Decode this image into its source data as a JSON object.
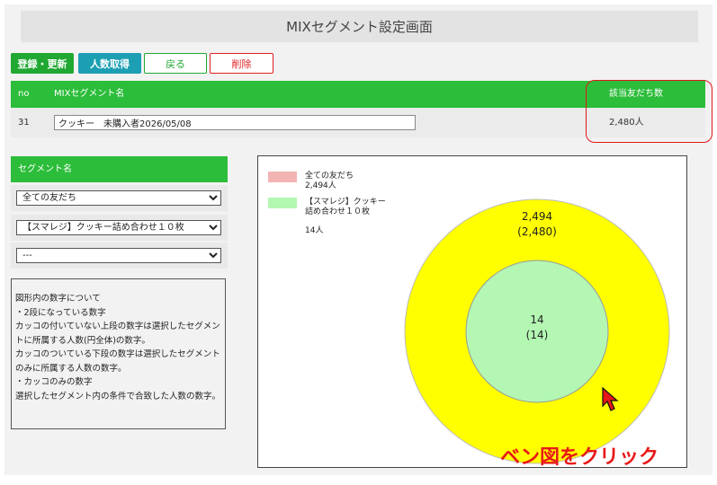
{
  "page": {
    "title": "MIXセグメント設定画面"
  },
  "toolbar": {
    "register_label": "登録・更新",
    "get_count_label": "人数取得",
    "back_label": "戻る",
    "delete_label": "削除"
  },
  "table": {
    "headers": {
      "no": "no",
      "name": "MIXセグメント名",
      "count": "該当友だち数"
    },
    "row": {
      "no": "31",
      "name": "クッキー　未購入者2026/05/08",
      "count": "2,480人"
    }
  },
  "segments": {
    "header": "セグメント名",
    "selects": [
      {
        "selected": "全ての友だち"
      },
      {
        "selected": "【スマレジ】クッキー詰め合わせ１０枚"
      },
      {
        "selected": "---"
      }
    ]
  },
  "info": {
    "lines": [
      "図形内の数字について",
      "・2段になっている数字",
      "カッコの付いていない上段の数字は選択したセグメントに所属する人数(円全体)の数字。",
      "カッコのついている下段の数字は選択したセグメントのみに所属する人数の数字。",
      "・カッコのみの数字",
      "選択したセグメント内の条件で合致した人数の数字。"
    ]
  },
  "venn": {
    "legend": [
      {
        "label": "全ての友だち",
        "count": "2,494人",
        "color": "#f4b3b3"
      },
      {
        "label": "【スマレジ】クッキー詰め合わせ１０枚",
        "count": "14人",
        "color": "#b3f7b3"
      }
    ],
    "outer": {
      "value": "2,494",
      "exclusive": "(2,480)",
      "color": "#ffff00"
    },
    "inner": {
      "value": "14",
      "exclusive": "(14)",
      "color": "#b3f7b3"
    }
  },
  "annotation": {
    "cta": "ベン図をクリック"
  },
  "colors": {
    "green": "#2cbd3a",
    "teal": "#1c9fb3",
    "red": "#e01818"
  }
}
